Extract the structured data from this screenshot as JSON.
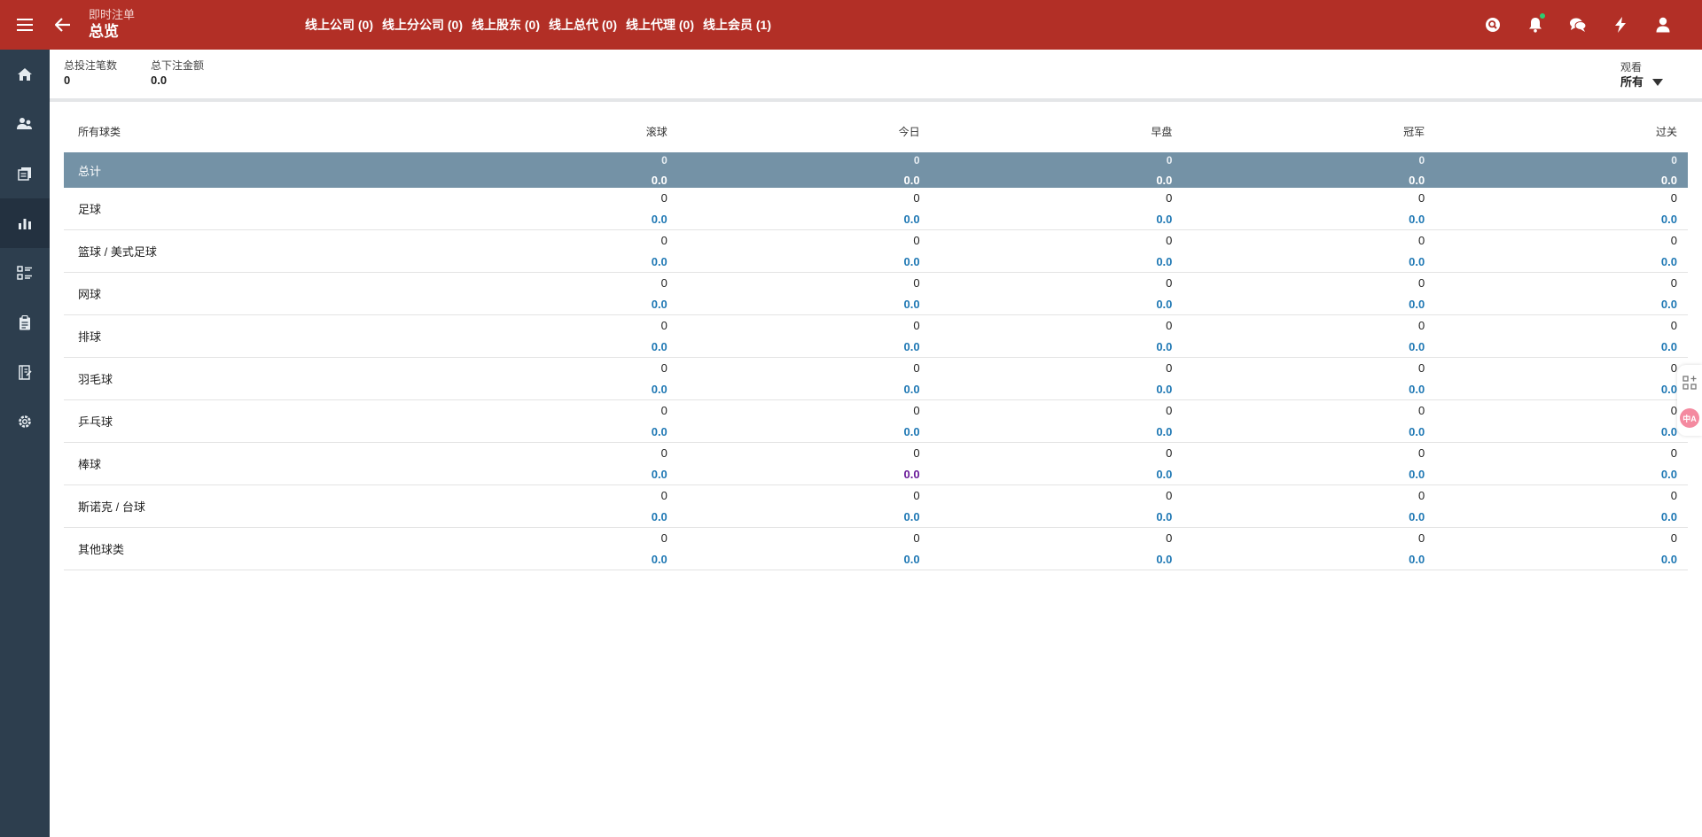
{
  "header": {
    "subtitle": "即时注单",
    "title": "总览",
    "levels": [
      {
        "label": "线上公司 (0)"
      },
      {
        "label": "线上分公司 (0)"
      },
      {
        "label": "线上股东 (0)"
      },
      {
        "label": "线上总代 (0)"
      },
      {
        "label": "线上代理 (0)"
      },
      {
        "label": "线上会员 (1)"
      }
    ],
    "icons": [
      "search-icon",
      "bell-icon",
      "chat-icon",
      "lightning-icon",
      "user-icon"
    ]
  },
  "sidebar": {
    "icons": [
      "home-icon",
      "users-icon",
      "documents-icon",
      "chart-icon",
      "list-icon",
      "clipboard-icon",
      "report-icon",
      "settings-icon"
    ],
    "active_index": 3
  },
  "summary": {
    "total_count_label": "总投注笔数",
    "total_count_value": "0",
    "total_amount_label": "总下注金额",
    "total_amount_value": "0.0"
  },
  "view_filter": {
    "label": "观看",
    "value": "所有"
  },
  "table": {
    "columns": [
      "所有球类",
      "滚球",
      "今日",
      "早盘",
      "冠军",
      "过关"
    ],
    "total": {
      "name": "总计",
      "cells": [
        {
          "count": "0",
          "amount": "0.0"
        },
        {
          "count": "0",
          "amount": "0.0"
        },
        {
          "count": "0",
          "amount": "0.0"
        },
        {
          "count": "0",
          "amount": "0.0"
        },
        {
          "count": "0",
          "amount": "0.0"
        }
      ]
    },
    "rows": [
      {
        "name": "足球",
        "cells": [
          {
            "count": "0",
            "amount": "0.0"
          },
          {
            "count": "0",
            "amount": "0.0"
          },
          {
            "count": "0",
            "amount": "0.0"
          },
          {
            "count": "0",
            "amount": "0.0"
          },
          {
            "count": "0",
            "amount": "0.0"
          }
        ]
      },
      {
        "name": "篮球 / 美式足球",
        "cells": [
          {
            "count": "0",
            "amount": "0.0"
          },
          {
            "count": "0",
            "amount": "0.0"
          },
          {
            "count": "0",
            "amount": "0.0"
          },
          {
            "count": "0",
            "amount": "0.0"
          },
          {
            "count": "0",
            "amount": "0.0"
          }
        ]
      },
      {
        "name": "网球",
        "cells": [
          {
            "count": "0",
            "amount": "0.0"
          },
          {
            "count": "0",
            "amount": "0.0"
          },
          {
            "count": "0",
            "amount": "0.0"
          },
          {
            "count": "0",
            "amount": "0.0"
          },
          {
            "count": "0",
            "amount": "0.0"
          }
        ]
      },
      {
        "name": "排球",
        "cells": [
          {
            "count": "0",
            "amount": "0.0"
          },
          {
            "count": "0",
            "amount": "0.0"
          },
          {
            "count": "0",
            "amount": "0.0"
          },
          {
            "count": "0",
            "amount": "0.0"
          },
          {
            "count": "0",
            "amount": "0.0"
          }
        ]
      },
      {
        "name": "羽毛球",
        "cells": [
          {
            "count": "0",
            "amount": "0.0"
          },
          {
            "count": "0",
            "amount": "0.0"
          },
          {
            "count": "0",
            "amount": "0.0"
          },
          {
            "count": "0",
            "amount": "0.0"
          },
          {
            "count": "0",
            "amount": "0.0"
          }
        ]
      },
      {
        "name": "乒乓球",
        "cells": [
          {
            "count": "0",
            "amount": "0.0"
          },
          {
            "count": "0",
            "amount": "0.0"
          },
          {
            "count": "0",
            "amount": "0.0"
          },
          {
            "count": "0",
            "amount": "0.0"
          },
          {
            "count": "0",
            "amount": "0.0"
          }
        ]
      },
      {
        "name": "棒球",
        "cells": [
          {
            "count": "0",
            "amount": "0.0"
          },
          {
            "count": "0",
            "amount": "0.0",
            "visited": true
          },
          {
            "count": "0",
            "amount": "0.0"
          },
          {
            "count": "0",
            "amount": "0.0"
          },
          {
            "count": "0",
            "amount": "0.0"
          }
        ]
      },
      {
        "name": "斯诺克 / 台球",
        "cells": [
          {
            "count": "0",
            "amount": "0.0"
          },
          {
            "count": "0",
            "amount": "0.0"
          },
          {
            "count": "0",
            "amount": "0.0"
          },
          {
            "count": "0",
            "amount": "0.0"
          },
          {
            "count": "0",
            "amount": "0.0"
          }
        ]
      },
      {
        "name": "其他球类",
        "cells": [
          {
            "count": "0",
            "amount": "0.0"
          },
          {
            "count": "0",
            "amount": "0.0"
          },
          {
            "count": "0",
            "amount": "0.0"
          },
          {
            "count": "0",
            "amount": "0.0"
          },
          {
            "count": "0",
            "amount": "0.0"
          }
        ]
      }
    ]
  },
  "colors": {
    "header_bg": "#b22f26",
    "sidebar_bg": "#2d3e4e",
    "total_row_bg": "#7492a6",
    "amount_link": "#1f78b4",
    "amount_visited": "#6a1b9a"
  },
  "float_tools": {
    "icons": [
      "add-widget-icon",
      "translate-icon"
    ],
    "translate_label": "中A"
  }
}
